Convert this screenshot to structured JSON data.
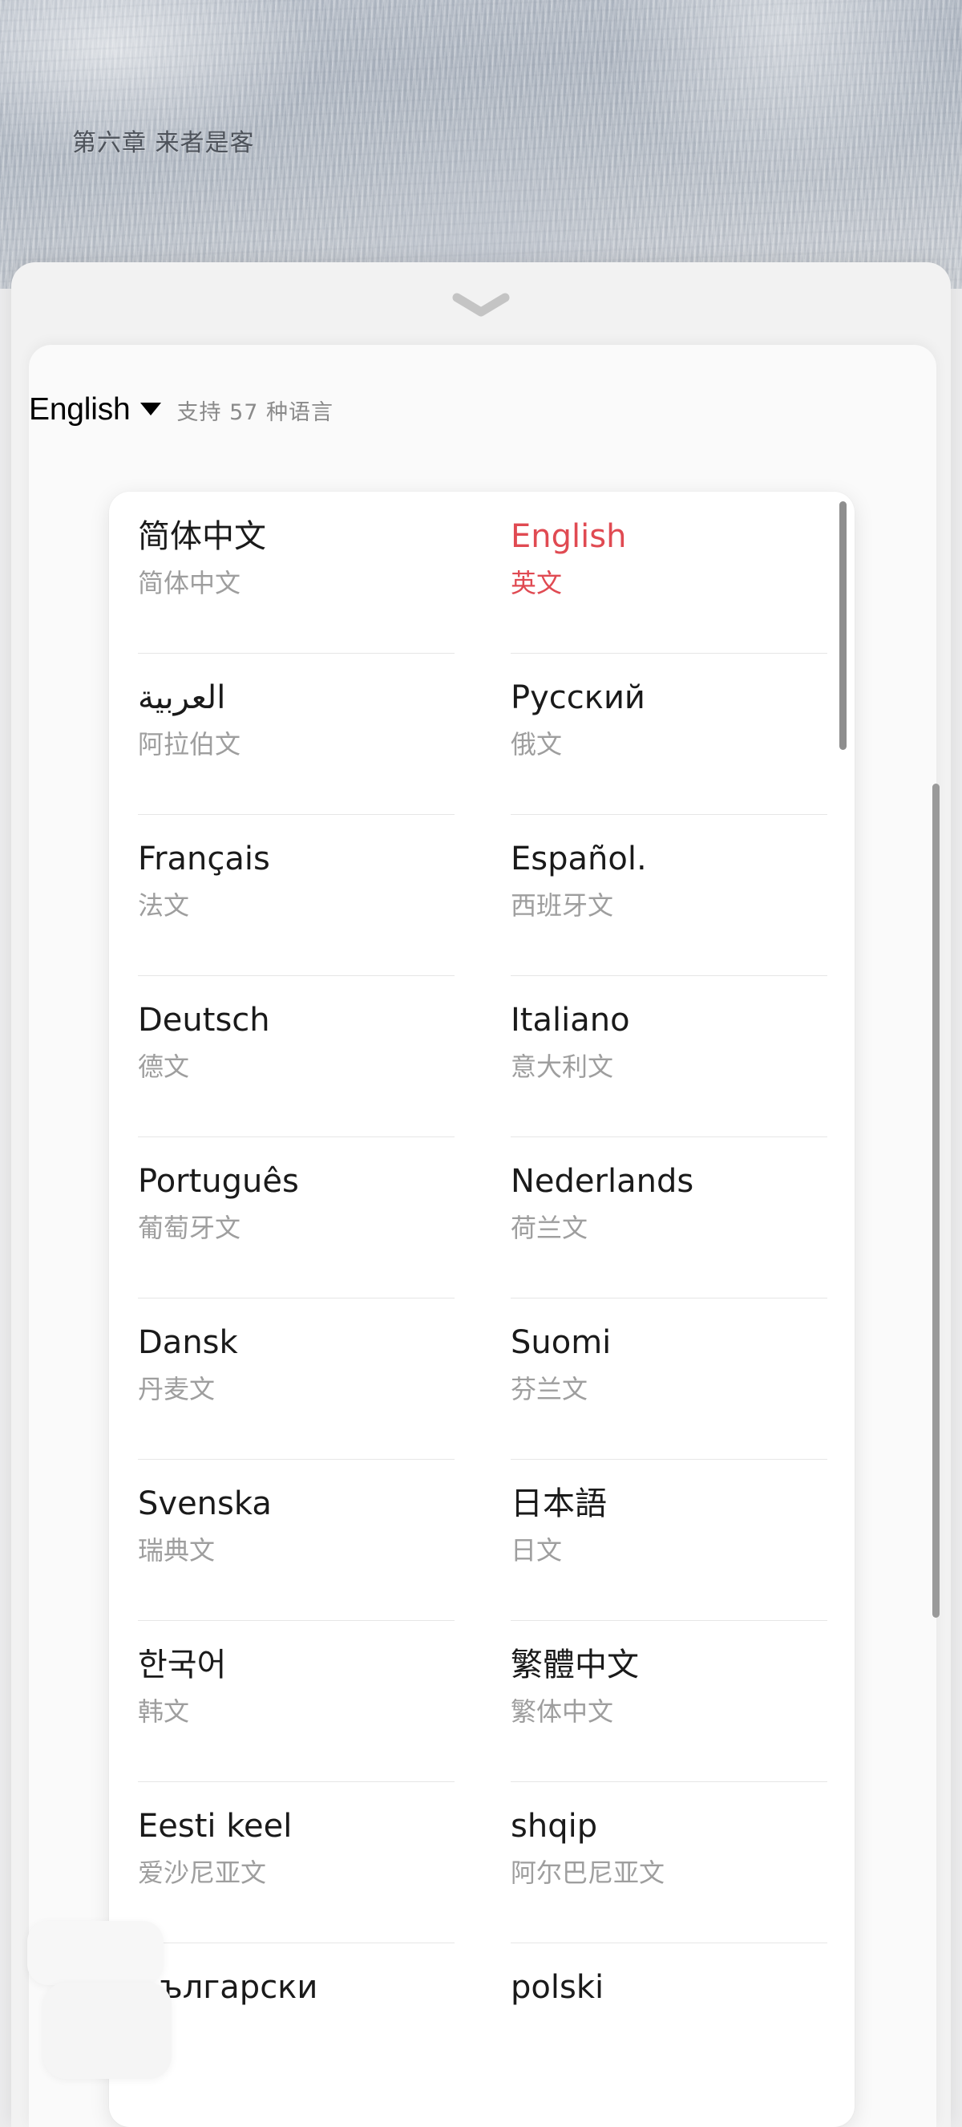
{
  "reader": {
    "chapter_title": "第六章 来者是客"
  },
  "sheet": {
    "handle_icon": "chevron-down-icon"
  },
  "header": {
    "current_language": "English",
    "caret_icon": "triangle-down-icon",
    "supported_count_text": "支持 57 种语言"
  },
  "colors": {
    "selected": "#e04a52",
    "native_text": "#1a1a1a",
    "secondary_text": "#9e9e9e",
    "card_bg": "#ffffff",
    "sheet_bg": "#f2f2f2",
    "scrollbar": "#8e8e8e"
  },
  "languages": [
    [
      {
        "native": "简体中文",
        "cn": "简体中文",
        "selected": false
      },
      {
        "native": "English",
        "cn": "英文",
        "selected": true
      }
    ],
    [
      {
        "native": "العربية",
        "cn": "阿拉伯文",
        "selected": false
      },
      {
        "native": "Русский",
        "cn": "俄文",
        "selected": false
      }
    ],
    [
      {
        "native": "Français",
        "cn": "法文",
        "selected": false
      },
      {
        "native": "Español.",
        "cn": "西班牙文",
        "selected": false
      }
    ],
    [
      {
        "native": "Deutsch",
        "cn": "德文",
        "selected": false
      },
      {
        "native": "Italiano",
        "cn": "意大利文",
        "selected": false
      }
    ],
    [
      {
        "native": "Português",
        "cn": "葡萄牙文",
        "selected": false
      },
      {
        "native": "Nederlands",
        "cn": "荷兰文",
        "selected": false
      }
    ],
    [
      {
        "native": "Dansk",
        "cn": "丹麦文",
        "selected": false
      },
      {
        "native": "Suomi",
        "cn": "芬兰文",
        "selected": false
      }
    ],
    [
      {
        "native": "Svenska",
        "cn": "瑞典文",
        "selected": false
      },
      {
        "native": "日本語",
        "cn": "日文",
        "selected": false
      }
    ],
    [
      {
        "native": "한국어",
        "cn": "韩文",
        "selected": false
      },
      {
        "native": "繁體中文",
        "cn": "繁体中文",
        "selected": false
      }
    ],
    [
      {
        "native": "Eesti keel",
        "cn": "爱沙尼亚文",
        "selected": false
      },
      {
        "native": "shqip",
        "cn": "阿尔巴尼亚文",
        "selected": false
      }
    ],
    [
      {
        "native": "Български",
        "cn": "",
        "selected": false
      },
      {
        "native": "polski",
        "cn": "",
        "selected": false
      }
    ]
  ]
}
